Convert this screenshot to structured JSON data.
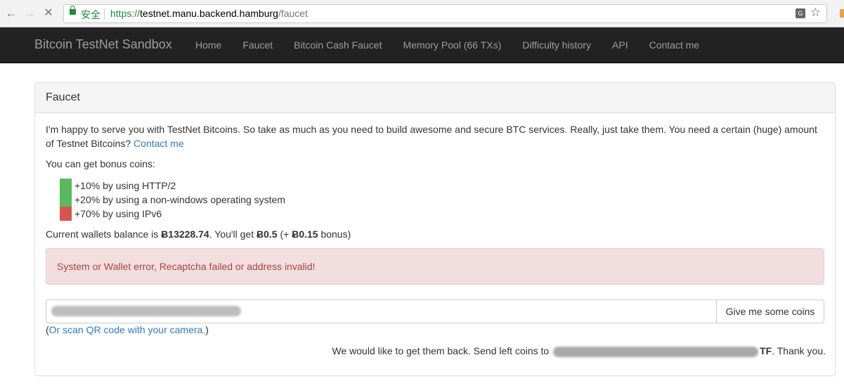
{
  "browser": {
    "secure_label": "安全",
    "url_scheme": "https://",
    "url_host": "testnet.manu.backend.hamburg",
    "url_path": "/faucet"
  },
  "navbar": {
    "brand": "Bitcoin TestNet Sandbox",
    "links": [
      "Home",
      "Faucet",
      "Bitcoin Cash Faucet",
      "Memory Pool (66 TXs)",
      "Difficulty history",
      "API",
      "Contact me"
    ]
  },
  "panel": {
    "title": "Faucet",
    "intro_text": "I'm happy to serve you with TestNet Bitcoins. So take as much as you need to build awesome and secure BTC services. Really, just take them. You need a certain (huge) amount of Testnet Bitcoins?",
    "intro_link": "Contact me",
    "bonus_heading": "You can get bonus coins:",
    "bonuses": [
      {
        "label": "+10% by using HTTP/2",
        "status": "green"
      },
      {
        "label": "+20% by using a non-windows operating system",
        "status": "green"
      },
      {
        "label": "+70% by using IPv6",
        "status": "red"
      }
    ],
    "balance_prefix": "Current wallets balance is ",
    "balance_value": "Ƀ13228.74",
    "balance_mid": ". You'll get ",
    "get_value": "Ƀ0.5",
    "bonus_open": " (+ ",
    "bonus_value": "Ƀ0.15",
    "bonus_close": " bonus)",
    "error_message": "System or Wallet error, Recaptcha failed or address invalid!",
    "submit_label": "Give me some coins",
    "qr_open": "(",
    "qr_link": "Or scan QR code with your camera.",
    "qr_close": ")",
    "return_prefix": "We would like to get them back. Send left coins to ",
    "return_suffix_bold": "TF",
    "return_suffix": ". Thank you."
  },
  "colors": {
    "navbar_bg": "#222222",
    "alert_bg": "#f2dede",
    "alert_text": "#a94442",
    "link": "#337ab7",
    "bonus_on": "#5cb85c",
    "bonus_off": "#d9534f"
  }
}
